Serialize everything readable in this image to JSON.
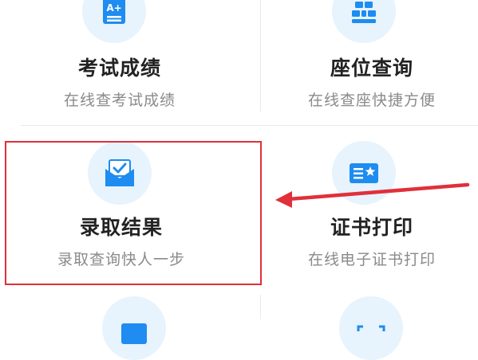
{
  "tiles": [
    {
      "title": "考试成绩",
      "subtitle": "在线查考试成绩",
      "icon": "exam-score-icon",
      "icon_text": "A+"
    },
    {
      "title": "座位查询",
      "subtitle": "在线查座快捷方便",
      "icon": "seat-query-icon"
    },
    {
      "title": "录取结果",
      "subtitle": "录取查询快人一步",
      "icon": "admission-envelope-icon"
    },
    {
      "title": "证书打印",
      "subtitle": "在线电子证书打印",
      "icon": "certificate-print-icon"
    }
  ],
  "colors": {
    "icon_blue": "#1e8cf0",
    "icon_bg": "#e7f3fd",
    "highlight_red": "#e0303a",
    "title": "#222222",
    "subtitle": "#8a8a8a"
  }
}
